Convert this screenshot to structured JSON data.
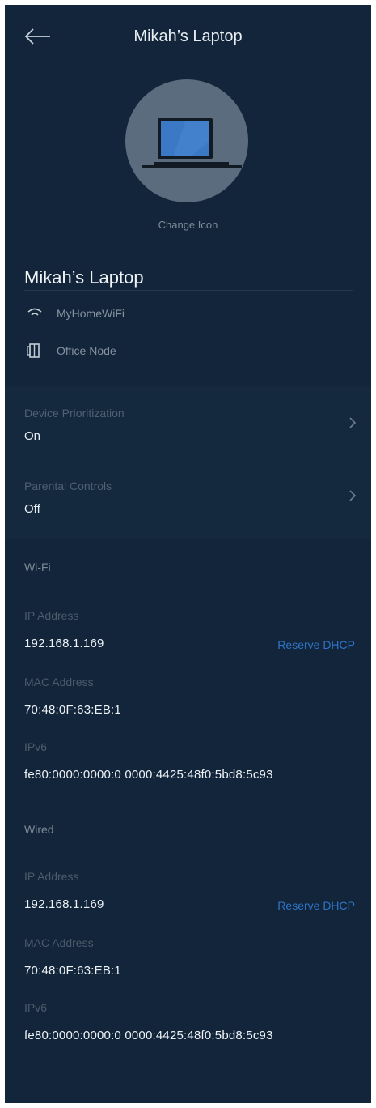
{
  "header": {
    "title": "Mikah’s Laptop",
    "back_icon": "arrow-left-icon"
  },
  "device": {
    "icon": "laptop-icon",
    "change_icon_label": "Change Icon",
    "name": "Mikah’s Laptop",
    "network": {
      "icon": "wifi-icon",
      "label": "MyHomeWiFi"
    },
    "node": {
      "icon": "node-icon",
      "label": "Office Node"
    }
  },
  "settings": [
    {
      "label": "Device Prioritization",
      "value": "On"
    },
    {
      "label": "Parental Controls",
      "value": "Off"
    }
  ],
  "wifi": {
    "title": "Wi-Fi",
    "ip_label": "IP Address",
    "ip_value": "192.168.1.169",
    "reserve_label": "Reserve DHCP",
    "mac_label": "MAC Address",
    "mac_value": "70:48:0F:63:EB:1",
    "ipv6_label": "IPv6",
    "ipv6_value": "fe80:0000:0000:0 0000:4425:48f0:5bd8:5c93"
  },
  "wired": {
    "title": "Wired",
    "ip_label": "IP Address",
    "ip_value": "192.168.1.169",
    "reserve_label": "Reserve DHCP",
    "mac_label": "MAC Address",
    "mac_value": "70:48:0F:63:EB:1",
    "ipv6_label": "IPv6",
    "ipv6_value": "fe80:0000:0000:0 0000:4425:48f0:5bd8:5c93"
  },
  "colors": {
    "background": "#12253a",
    "link": "#2f74c8",
    "avatar": "#5a6c7d",
    "laptop_screen": "#3b78c6"
  }
}
